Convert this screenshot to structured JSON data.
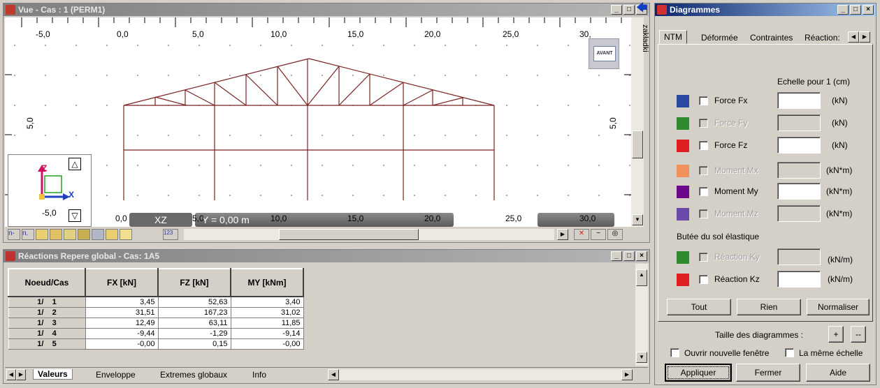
{
  "view_window": {
    "title": "Vue - Cas : 1 (PERM1)",
    "side_label": "zakładki",
    "ruler_top": [
      "-5,0",
      "0,0",
      "5,0",
      "10,0",
      "15,0",
      "20,0",
      "25,0",
      "30,"
    ],
    "ruler_side": [
      "5,0",
      "5,0"
    ],
    "view_cube_label": "AVANT",
    "axis_labels": {
      "z": "Z",
      "x": "X"
    },
    "gizmo_value": "-5,0",
    "plane": "XZ",
    "coord": "Y = 0,00 m",
    "bottom_ruler": [
      "0,0",
      "5,0",
      "10,0",
      "15,0",
      "20,0",
      "25,0",
      "30,0"
    ],
    "toolbar_texts": [
      "n-",
      "n.",
      "123"
    ],
    "colors": {
      "frame": "#7a2222",
      "grid_dot": "#6f6f6f",
      "bg": "#ffffff"
    }
  },
  "reactions_window": {
    "title": "Réactions Repere global - Cas:  1A5",
    "columns": [
      "Noeud/Cas",
      "FX [kN]",
      "FZ [kN]",
      "MY [kNm]"
    ],
    "rows": [
      {
        "node": "1/",
        "cas": "1",
        "fx": "3,45",
        "fz": "52,63",
        "my": "3,40"
      },
      {
        "node": "1/",
        "cas": "2",
        "fx": "31,51",
        "fz": "167,23",
        "my": "31,02"
      },
      {
        "node": "1/",
        "cas": "3",
        "fx": "12,49",
        "fz": "63,11",
        "my": "11,85"
      },
      {
        "node": "1/",
        "cas": "4",
        "fx": "-9,44",
        "fz": "-1,29",
        "my": "-9,14"
      },
      {
        "node": "1/",
        "cas": "5",
        "fx": "-0,00",
        "fz": "0,15",
        "my": "-0,00"
      }
    ],
    "tabs": [
      "Valeurs",
      "Enveloppe",
      "Extremes globaux",
      "Info"
    ]
  },
  "diagram_window": {
    "title": "Diagrammes",
    "tabs": [
      "NTM",
      "Déformée",
      "Contraintes",
      "Réaction:"
    ],
    "scale_label": "Echelle pour 1  (cm)",
    "items": [
      {
        "label": "Force Fx",
        "unit": "(kN)",
        "color": "#2a4aa0",
        "enabled": true
      },
      {
        "label": "Force Fy",
        "unit": "(kN)",
        "color": "#2e8b2e",
        "enabled": false
      },
      {
        "label": "Force Fz",
        "unit": "(kN)",
        "color": "#e02020",
        "enabled": true
      },
      {
        "label": "Moment Mx",
        "unit": "(kN*m)",
        "color": "#f0905a",
        "enabled": false
      },
      {
        "label": "Moment My",
        "unit": "(kN*m)",
        "color": "#6a0a8a",
        "enabled": true
      },
      {
        "label": "Moment Mz",
        "unit": "(kN*m)",
        "color": "#6a4aa8",
        "enabled": false
      }
    ],
    "soil_label": "Butée du sol élastique",
    "soil_items": [
      {
        "label": "Réaction Ky",
        "unit": "(kN/m)",
        "color": "#2e8b2e",
        "enabled": false
      },
      {
        "label": "Réaction Kz",
        "unit": "(kN/m)",
        "color": "#e02020",
        "enabled": true
      }
    ],
    "btn_tout": "Tout",
    "btn_rien": "Rien",
    "btn_normaliser": "Normaliser",
    "size_label": "Taille des diagrammes :",
    "size_plus": "+",
    "size_minus": "--",
    "open_new": "Ouvrir nouvelle fenêtre",
    "same_scale": "La même échelle",
    "btn_apply": "Appliquer",
    "btn_close": "Fermer",
    "btn_help": "Aide"
  }
}
